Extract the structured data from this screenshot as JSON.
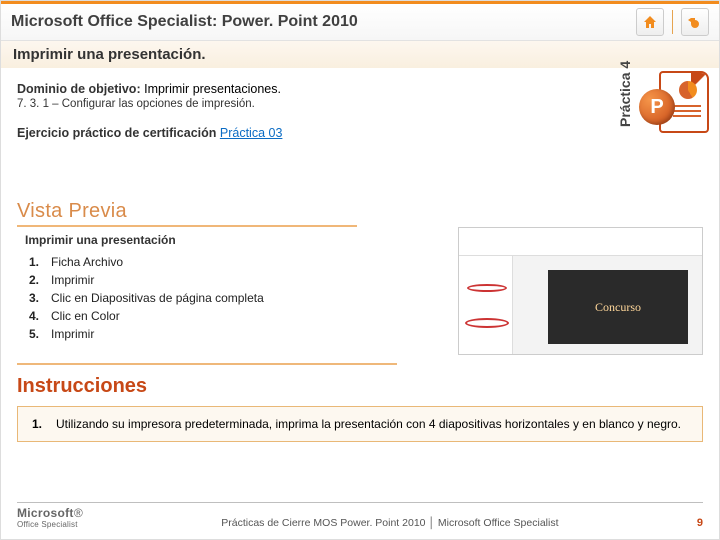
{
  "header": {
    "title": "Microsoft Office Specialist: Power. Point 2010"
  },
  "subtitle": "Imprimir una presentación.",
  "domain": {
    "label": "Dominio de objetivo:",
    "value": "Imprimir presentaciones.",
    "sub": "7. 3. 1 – Configurar las opciones de impresión."
  },
  "exercise": {
    "label": "Ejercicio práctico de certificación",
    "link_text": "Práctica 03"
  },
  "right": {
    "vertical": "Práctica 4",
    "badge": "P"
  },
  "preview": {
    "heading": "Vista Previa",
    "sub": "Imprimir una presentación",
    "steps": [
      "Ficha Archivo",
      "Imprimir",
      "Clic en Diapositivas de página completa",
      "Clic en Color",
      "Imprimir"
    ],
    "thumb_slide": "Concurso"
  },
  "instructions": {
    "heading": "Instrucciones",
    "items": [
      "Utilizando su impresora predeterminada, imprima la presentación con 4 diapositivas horizontales y en blanco y negro."
    ]
  },
  "footer": {
    "logo_brand_bold": "Microsoft",
    "logo_program": "Office Specialist",
    "center": "Prácticas de Cierre MOS Power. Point 2010 │ Microsoft Office Specialist",
    "page": "9"
  }
}
